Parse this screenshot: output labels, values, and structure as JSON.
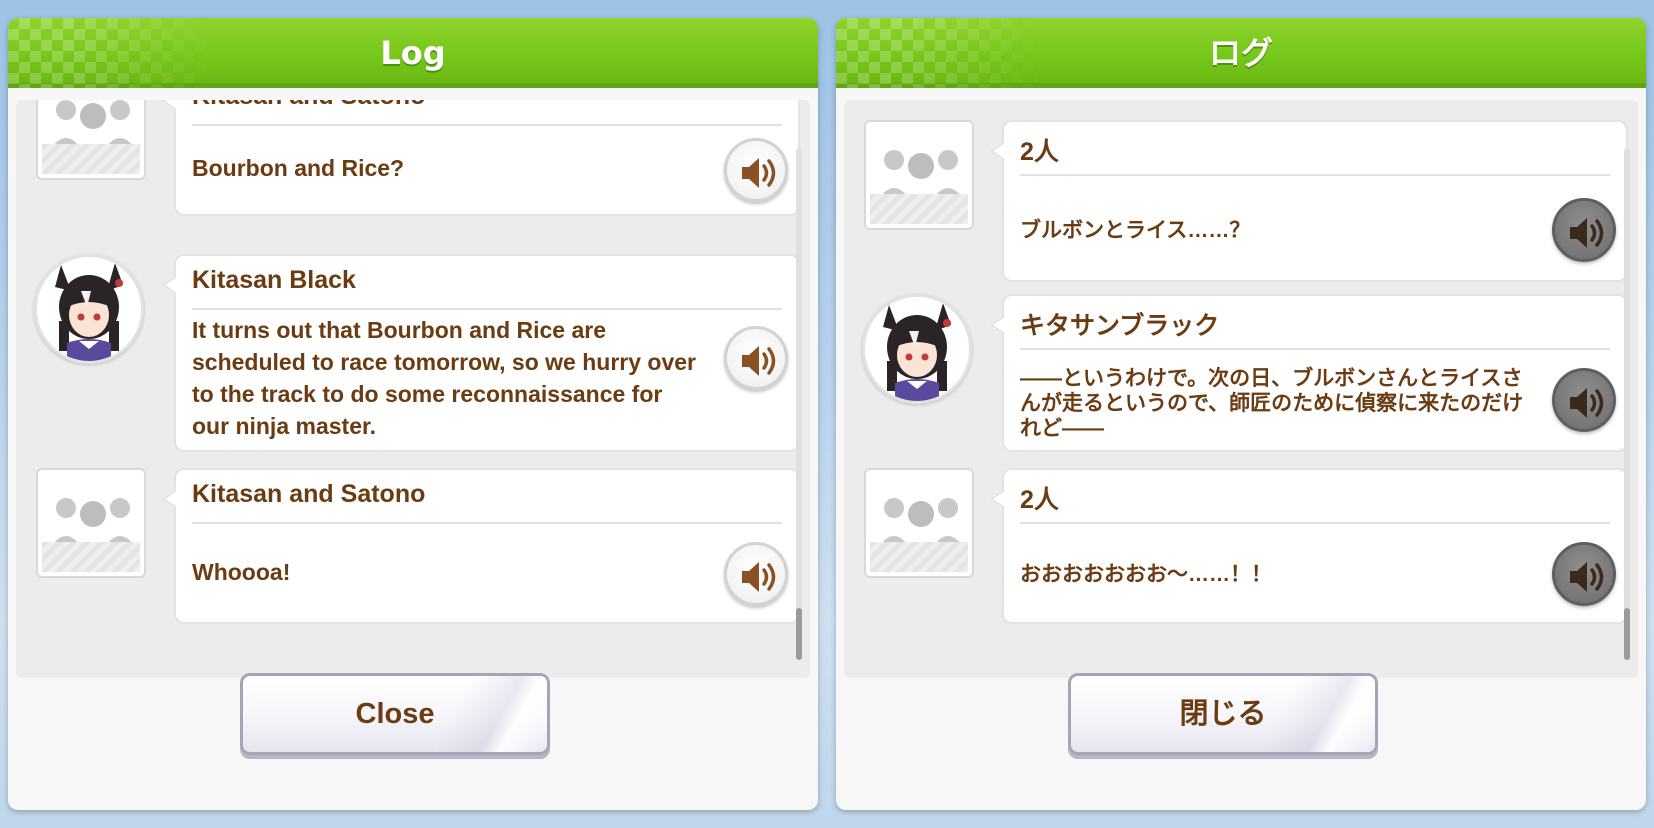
{
  "left": {
    "title": "Log",
    "entries": [
      {
        "avatar": "group-avatar-icon",
        "name": "Kitasan and Satono",
        "text": "Bourbon and Rice?",
        "voice": "speaker-icon"
      },
      {
        "avatar": "kitasan-black-portrait",
        "name": "Kitasan Black",
        "text": "It turns out that Bourbon and Rice are scheduled to race tomorrow, so we hurry over to the track to do some reconnaissance for our ninja master.",
        "voice": "speaker-icon"
      },
      {
        "avatar": "group-avatar-icon",
        "name": "Kitasan and Satono",
        "text": "Whoooa!",
        "voice": "speaker-icon"
      }
    ],
    "close_label": "Close"
  },
  "right": {
    "title": "ログ",
    "entries": [
      {
        "avatar": "group-avatar-icon",
        "name": "2人",
        "text": "ブルボンとライス……？",
        "voice": "speaker-icon"
      },
      {
        "avatar": "kitasan-black-portrait",
        "name": "キタサンブラック",
        "text": "――というわけで。次の日、ブルボンさんとライスさんが走るというので、師匠のために偵察に来たのだけれど――",
        "voice": "speaker-icon"
      },
      {
        "avatar": "group-avatar-icon",
        "name": "2人",
        "text": "おおおおおおお～……！！",
        "voice": "speaker-icon"
      }
    ],
    "close_label": "閉じる"
  },
  "colors": {
    "header_green": "#76c61a",
    "text_brown": "#6b3b12",
    "panel_bg": "#f7f7f7"
  }
}
